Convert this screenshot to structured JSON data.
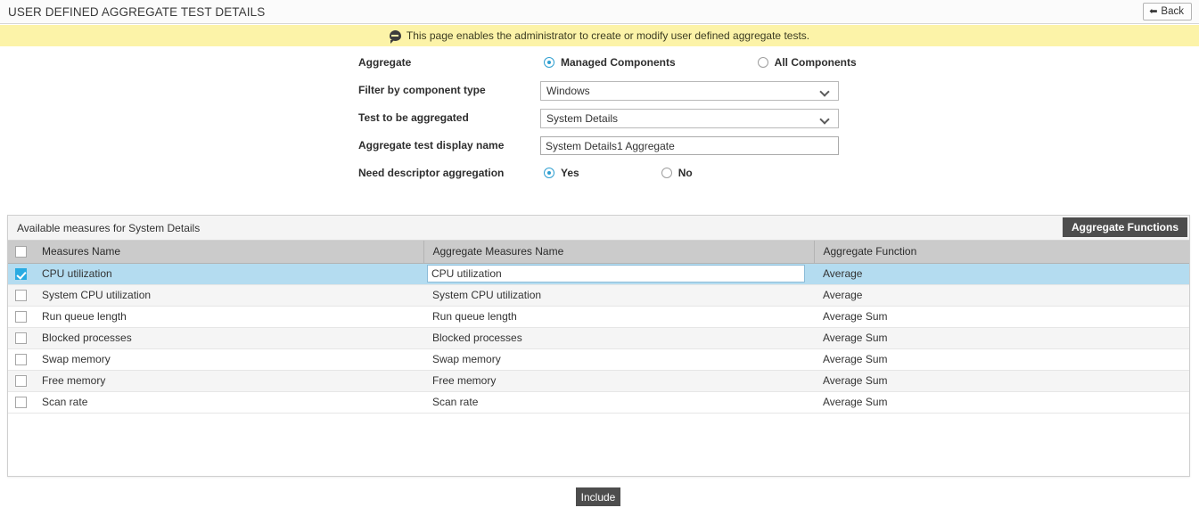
{
  "titlebar": {
    "title": "USER DEFINED AGGREGATE TEST DETAILS",
    "back_label": "Back",
    "back_icon": "back-arrow-icon"
  },
  "banner": {
    "icon": "info-speech-bubble-icon",
    "text": "This page enables the administrator to create or modify user defined aggregate tests."
  },
  "form": {
    "aggregate": {
      "label": "Aggregate",
      "options": [
        {
          "label": "Managed Components",
          "checked": true
        },
        {
          "label": "All Components",
          "checked": false
        }
      ]
    },
    "filter_by_component_type": {
      "label": "Filter by component type",
      "value": "Windows",
      "icon": "chevron-down-icon"
    },
    "test_to_be_aggregated": {
      "label": "Test to be aggregated",
      "value": "System Details",
      "icon": "chevron-down-icon"
    },
    "aggregate_test_display_name": {
      "label": "Aggregate test display name",
      "value": "System Details1 Aggregate",
      "placeholder": ""
    },
    "need_descriptor_aggregation": {
      "label": "Need descriptor aggregation",
      "options": [
        {
          "label": "Yes",
          "checked": true
        },
        {
          "label": "No",
          "checked": false
        }
      ]
    }
  },
  "panel": {
    "title": "Available measures for System Details",
    "aggregate_functions_button": "Aggregate Functions",
    "columns": [
      "Measures Name",
      "Aggregate Measures Name",
      "Aggregate Function"
    ],
    "rows": [
      {
        "checked": true,
        "measure": "CPU utilization",
        "aggregate_measure": "CPU utilization",
        "aggregate_function": "Average",
        "editing": true
      },
      {
        "checked": false,
        "measure": "System CPU utilization",
        "aggregate_measure": "System CPU utilization",
        "aggregate_function": "Average",
        "editing": false
      },
      {
        "checked": false,
        "measure": "Run queue length",
        "aggregate_measure": "Run queue length",
        "aggregate_function": "Average Sum",
        "editing": false
      },
      {
        "checked": false,
        "measure": "Blocked processes",
        "aggregate_measure": "Blocked processes",
        "aggregate_function": "Average Sum",
        "editing": false
      },
      {
        "checked": false,
        "measure": "Swap memory",
        "aggregate_measure": "Swap memory",
        "aggregate_function": "Average Sum",
        "editing": false
      },
      {
        "checked": false,
        "measure": "Free memory",
        "aggregate_measure": "Free memory",
        "aggregate_function": "Average Sum",
        "editing": false
      },
      {
        "checked": false,
        "measure": "Scan rate",
        "aggregate_measure": "Scan rate",
        "aggregate_function": "Average Sum",
        "editing": false
      }
    ]
  },
  "footer": {
    "include_button": "Include"
  },
  "colors": {
    "banner_bg": "#fcf3a8",
    "table_header_bg": "#cbcbcb",
    "selected_row_bg": "#b4dcf0",
    "accent_blue": "#29abe2",
    "dark_button_bg": "#4d4d4d"
  }
}
